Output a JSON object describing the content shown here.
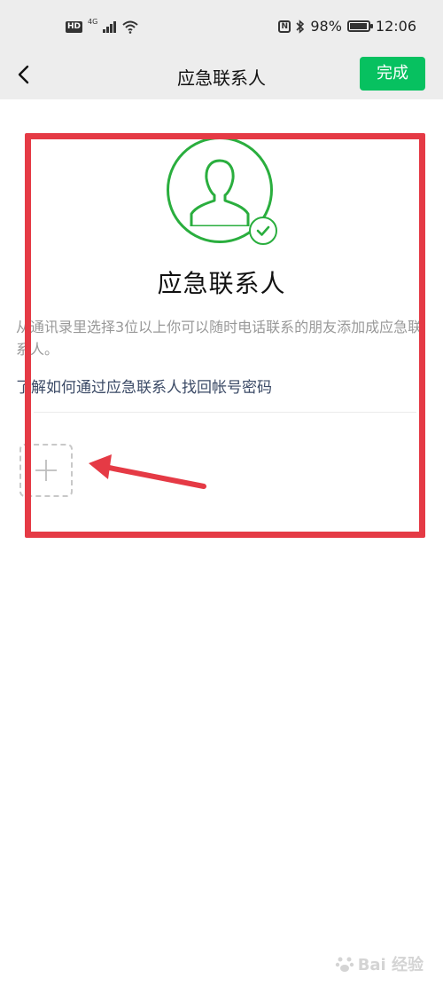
{
  "status_bar": {
    "hd_badge": "HD",
    "network": "4G",
    "battery": "98%",
    "time": "12:06"
  },
  "nav": {
    "title": "应急联系人",
    "done_label": "完成"
  },
  "main": {
    "heading": "应急联系人",
    "description": "从通讯录里选择3位以上你可以随时电话联系的朋友添加成应急联系人。",
    "help_link": "了解如何通过应急联系人找回帐号密码"
  },
  "watermark": {
    "text": "Bai 经验"
  },
  "colors": {
    "accent": "#07c160",
    "avatar_stroke": "#2aae3e",
    "annotation": "#e53a45"
  },
  "icons": [
    "back-icon",
    "avatar-icon",
    "check-icon",
    "plus-icon",
    "wifi-icon",
    "bluetooth-icon",
    "nfc-icon",
    "battery-icon"
  ]
}
